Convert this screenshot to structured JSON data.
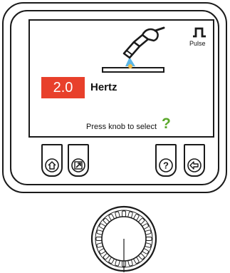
{
  "screen": {
    "value": "2.0",
    "unit": "Hertz",
    "hint": "Press knob to select",
    "hint_mark": "?",
    "mode_label": "Pulse",
    "mode_icon": "pulse-waveform-icon",
    "process_icon": "welding-torch-icon"
  },
  "buttons": [
    {
      "icon": "home-icon"
    },
    {
      "icon": "external-link-icon"
    },
    {
      "icon": "help-icon"
    },
    {
      "icon": "back-arrow-icon"
    }
  ],
  "knob": {
    "icon": "rotary-knob-icon"
  },
  "colors": {
    "value_background": "#e8402b",
    "hint_mark": "#5aa82a",
    "arc_glow": "#3fa9e0",
    "outline": "#1a1a1a"
  }
}
